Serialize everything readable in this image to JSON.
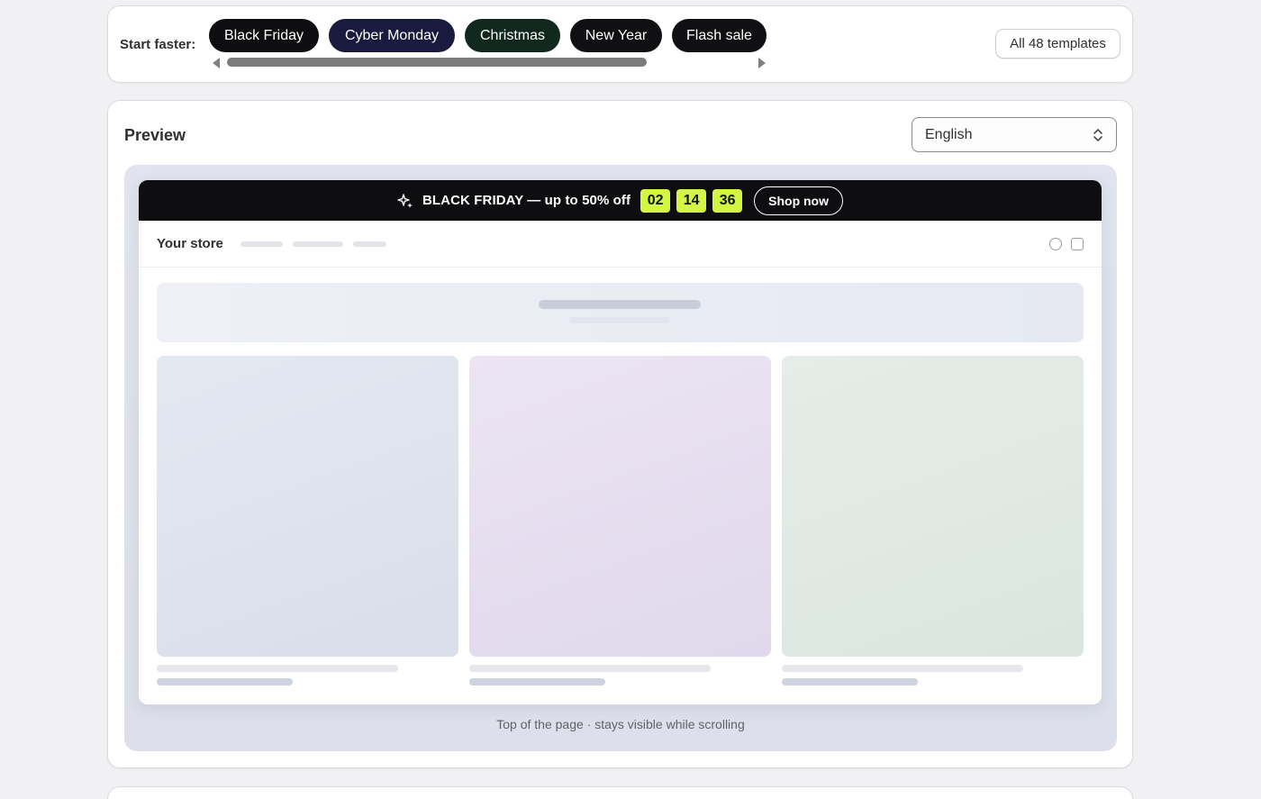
{
  "start": {
    "label": "Start faster:",
    "chips": [
      "Black Friday",
      "Cyber Monday",
      "Christmas",
      "New Year",
      "Flash sale"
    ],
    "all_templates": "All 48 templates"
  },
  "preview": {
    "title": "Preview",
    "language": "English",
    "announcement": {
      "icon": "sparkle-icon",
      "text": "BLACK FRIDAY — up to 50% off",
      "timer": [
        "02",
        "14",
        "36"
      ],
      "cta": "Shop now",
      "timer_color": "#d4f542",
      "bar_color": "#0e0e10"
    },
    "store": {
      "name": "Your store",
      "icons": [
        "search-icon",
        "cart-icon"
      ]
    },
    "caption": "Top of the page · stays visible while scrolling"
  }
}
